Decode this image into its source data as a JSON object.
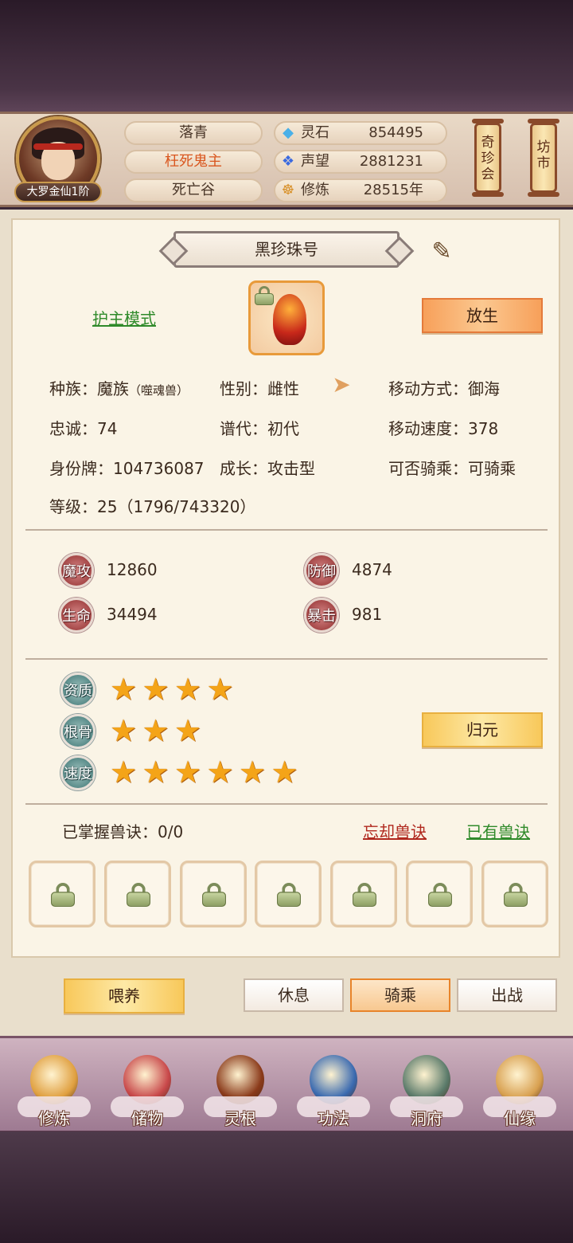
{
  "header": {
    "rank": "大罗金仙1阶",
    "name": "落青",
    "title": "枉死鬼主",
    "location": "死亡谷",
    "stats": [
      {
        "icon": "spirit-stone-icon",
        "glyph": "◆",
        "label": "灵石",
        "value": "854495"
      },
      {
        "icon": "reputation-icon",
        "glyph": "❖",
        "label": "声望",
        "value": "2881231"
      },
      {
        "icon": "meditation-icon",
        "glyph": "☸",
        "label": "修炼",
        "value": "28515年"
      }
    ],
    "right_buttons": [
      "奇珍会",
      "坊市"
    ]
  },
  "pet": {
    "name": "黑珍珠号",
    "mode_link": "护主模式",
    "release_button": "放生",
    "info": {
      "race_label": "种族：",
      "race": "魔族",
      "race_sub": "（噬魂兽）",
      "gender_label": "性别：",
      "gender": "雌性",
      "move_label": "移动方式：",
      "move": "御海",
      "loyalty_label": "忠诚：",
      "loyalty": "74",
      "gen_label": "谱代：",
      "gen": "初代",
      "speed_label": "移动速度：",
      "speed": "378",
      "id_label": "身份牌：",
      "id": "104736087",
      "growth_label": "成长：",
      "growth": "攻击型",
      "ride_label": "可否骑乘：",
      "ride": "可骑乘",
      "level_label": "等级：",
      "level": "25（1796/743320）"
    },
    "attrs": [
      {
        "label": "魔攻",
        "value": "12860"
      },
      {
        "label": "防御",
        "value": "4874"
      },
      {
        "label": "生命",
        "value": "34494"
      },
      {
        "label": "暴击",
        "value": "981"
      }
    ],
    "qualities": [
      {
        "label": "资质",
        "stars": 4
      },
      {
        "label": "根骨",
        "stars": 3
      },
      {
        "label": "速度",
        "stars": 6
      }
    ],
    "reset_button": "归元",
    "skills_label": "已掌握兽诀：0/0",
    "forget_link": "忘却兽诀",
    "owned_link": "已有兽诀",
    "slot_count": 7
  },
  "actions": {
    "feed": "喂养",
    "tabs": [
      "休息",
      "骑乘",
      "出战"
    ],
    "active_tab": "骑乘"
  },
  "nav": [
    {
      "label": "修炼",
      "icon": "cultivate-icon",
      "color": "#e0a040"
    },
    {
      "label": "储物",
      "icon": "storage-bag-icon",
      "color": "#c8484a"
    },
    {
      "label": "灵根",
      "icon": "spirit-root-icon",
      "color": "#8a3a1a"
    },
    {
      "label": "功法",
      "icon": "skill-book-icon",
      "color": "#3a6ab0"
    },
    {
      "label": "洞府",
      "icon": "cave-palace-icon",
      "color": "#5a7a6a"
    },
    {
      "label": "仙缘",
      "icon": "gourd-icon",
      "color": "#d8a050"
    }
  ]
}
